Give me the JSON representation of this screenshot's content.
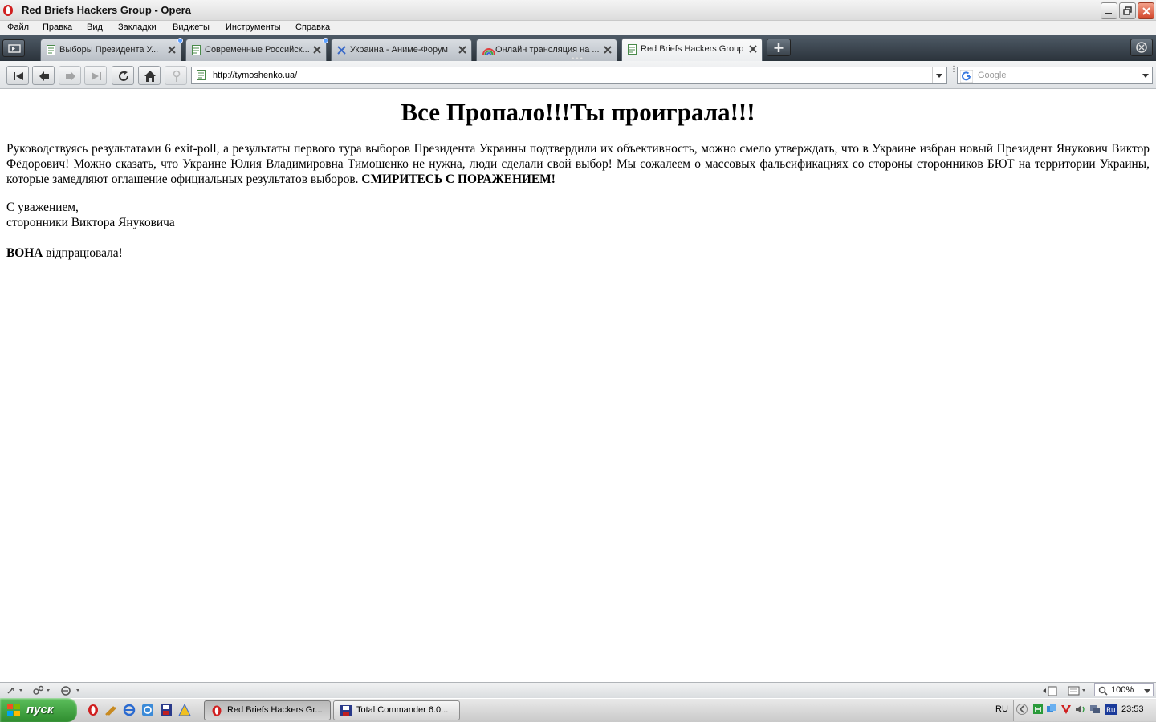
{
  "window": {
    "title": "Red Briefs Hackers Group - Opera"
  },
  "menu": [
    "Файл",
    "Правка",
    "Вид",
    "Закладки",
    "Виджеты",
    "Инструменты",
    "Справка"
  ],
  "tabs": [
    {
      "label": "Выборы Президента У...",
      "active": false
    },
    {
      "label": "Современные Российск...",
      "active": false
    },
    {
      "label": "Украина - Аниме-Форум",
      "active": false
    },
    {
      "label": "Онлайн трансляция на ...",
      "active": false
    },
    {
      "label": "Red Briefs Hackers Group",
      "active": true
    }
  ],
  "address": {
    "url": "http://tymoshenko.ua/"
  },
  "search": {
    "placeholder": "Google"
  },
  "page": {
    "heading": "Все Пропало!!!Ты проиграла!!!",
    "intro_text": "Руководствуясь результатами 6 exit-poll, а результаты первого тура выборов Президента Украины подтвердили их объективность, можно смело утверждать, что в Украине избран новый Президент Янукович Виктор Фёдорович! Можно сказать, что Украине Юлия Владимировна Тимошенко не нужна, люди сделали свой выбор! Мы сожалеем о массовых фальсификациях со стороны сторонников БЮТ на территории Украины, которые замедляют оглашение официальных результатов выборов.",
    "intro_bold": "СМИРИТЕСЬ С ПОРАЖЕНИЕМ!",
    "sign_line1": "С уважением,",
    "sign_line2": "сторонники Виктора Януковича",
    "footer_bold": "ВОНА",
    "footer_text": " відпрацювала!"
  },
  "statusbar": {
    "zoom": "100%"
  },
  "taskbar": {
    "start_label": "пуск",
    "tasks": [
      {
        "label": "Red Briefs Hackers Gr...",
        "active": true
      },
      {
        "label": "Total Commander 6.0...",
        "active": false
      }
    ],
    "lang": "RU",
    "tray_lang": "Ru",
    "clock": "23:53"
  },
  "colors": {
    "tab_bar": "#3a434c",
    "start_green": "#3a9a3a",
    "opera_red": "#d02020"
  }
}
